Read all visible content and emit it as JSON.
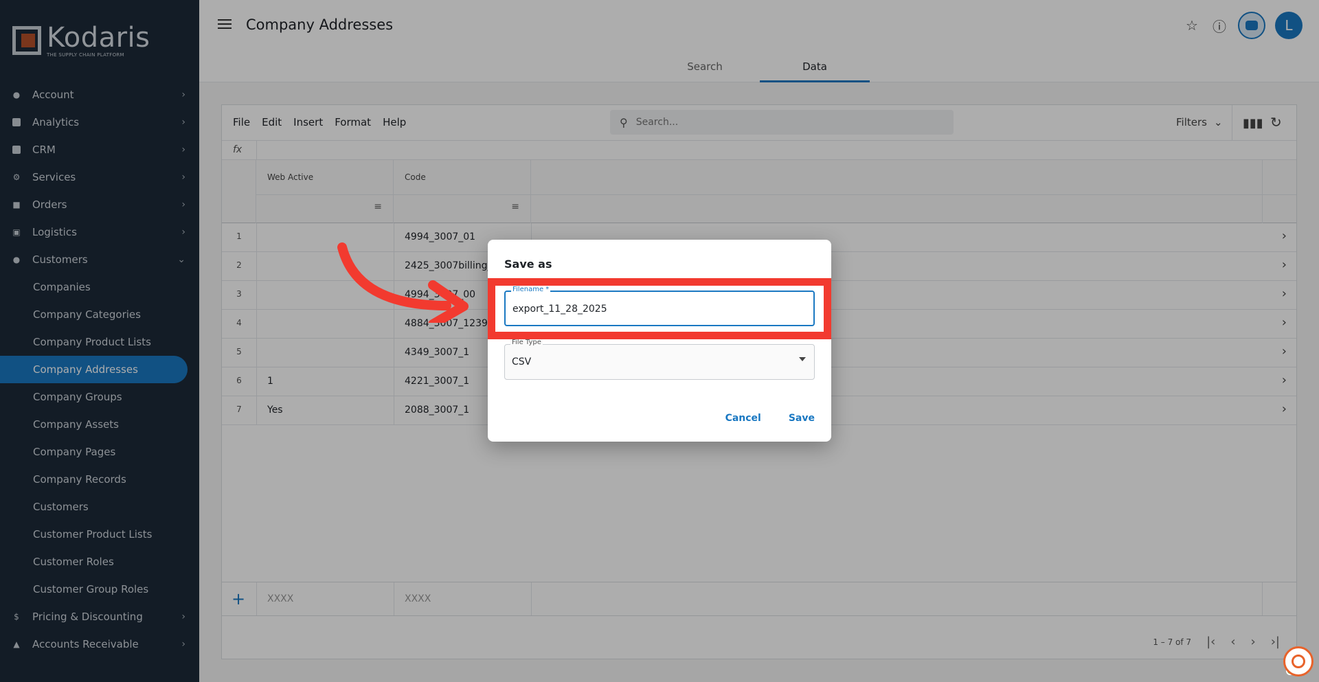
{
  "app": {
    "logo_name": "Kodaris",
    "logo_tagline": "THE SUPPLY CHAIN PLATFORM"
  },
  "sidebar": {
    "items": [
      {
        "label": "Account",
        "icon": "person-icon"
      },
      {
        "label": "Analytics",
        "icon": "chart-icon"
      },
      {
        "label": "CRM",
        "icon": "contact-card-icon"
      },
      {
        "label": "Services",
        "icon": "gears-icon"
      },
      {
        "label": "Orders",
        "icon": "truck-icon"
      },
      {
        "label": "Logistics",
        "icon": "delivery-icon"
      },
      {
        "label": "Customers",
        "icon": "people-icon"
      }
    ],
    "customers_sub": [
      "Companies",
      "Company Categories",
      "Company Product Lists",
      "Company Addresses",
      "Company Groups",
      "Company Assets",
      "Company Pages",
      "Company Records",
      "Customers",
      "Customer Product Lists",
      "Customer Roles",
      "Customer Group Roles"
    ],
    "bottom_items": [
      {
        "label": "Pricing & Discounting",
        "icon": "dollar-icon"
      },
      {
        "label": "Accounts Receivable",
        "icon": "bank-icon"
      }
    ]
  },
  "header": {
    "title": "Company Addresses",
    "avatar_letter": "L",
    "tabs": [
      "Search",
      "Data"
    ],
    "active_tab": "Data"
  },
  "toolbar": {
    "menu": [
      "File",
      "Edit",
      "Insert",
      "Format",
      "Help"
    ],
    "search_placeholder": "Search...",
    "filters_label": "Filters",
    "fx_label": "fx"
  },
  "grid": {
    "columns": [
      "Web Active",
      "Code"
    ],
    "rows": [
      {
        "num": "1",
        "web_active": "",
        "code": "4994_3007_01"
      },
      {
        "num": "2",
        "web_active": "",
        "code": "2425_3007billing_"
      },
      {
        "num": "3",
        "web_active": "",
        "code": "4994_3007_00"
      },
      {
        "num": "4",
        "web_active": "",
        "code": "4884_3007_1239"
      },
      {
        "num": "5",
        "web_active": "",
        "code": "4349_3007_1"
      },
      {
        "num": "6",
        "web_active": "1",
        "code": "4221_3007_1"
      },
      {
        "num": "7",
        "web_active": "Yes",
        "code": "2088_3007_1"
      }
    ],
    "new_row_placeholder": "XXXX",
    "pagination": "1 – 7 of 7"
  },
  "dialog": {
    "title": "Save as",
    "filename_label": "Filename *",
    "filename_value": "export_11_28_2025",
    "filetype_label": "File Type",
    "filetype_value": "CSV",
    "cancel_label": "Cancel",
    "save_label": "Save"
  },
  "colors": {
    "accent": "#1a78c2",
    "sidebar_bg": "#1c2a38",
    "highlight": "#f23a2f",
    "chat": "#e8632b"
  }
}
